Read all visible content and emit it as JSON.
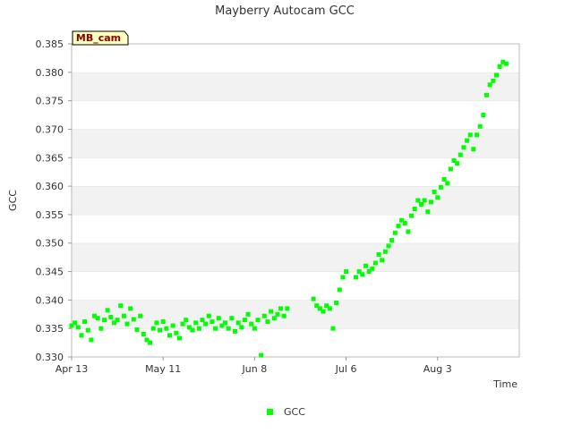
{
  "chart_data": {
    "type": "scatter",
    "title": "Mayberry Autocam GCC",
    "xlabel": "Time",
    "ylabel": "GCC",
    "site_tag": "MB_cam",
    "x_domain": [
      "2023-04-13",
      "2023-08-28"
    ],
    "xticks": [
      {
        "date": "2023-04-13",
        "label": "Apr 13"
      },
      {
        "date": "2023-05-11",
        "label": "May 11"
      },
      {
        "date": "2023-06-08",
        "label": "Jun 8"
      },
      {
        "date": "2023-07-06",
        "label": "Jul 6"
      },
      {
        "date": "2023-08-03",
        "label": "Aug 3"
      }
    ],
    "ylim": [
      0.33,
      0.385
    ],
    "yticks": [
      "0.330",
      "0.335",
      "0.340",
      "0.345",
      "0.350",
      "0.355",
      "0.360",
      "0.365",
      "0.370",
      "0.375",
      "0.380",
      "0.385"
    ],
    "grid": "alternating horizontal bands",
    "legend_position": "bottom-center",
    "series": [
      {
        "name": "GCC",
        "color": "#00ff00",
        "points": [
          [
            "2023-04-13",
            0.3355
          ],
          [
            "2023-04-14",
            0.336
          ],
          [
            "2023-04-15",
            0.3352
          ],
          [
            "2023-04-16",
            0.3338
          ],
          [
            "2023-04-17",
            0.3362
          ],
          [
            "2023-04-18",
            0.3347
          ],
          [
            "2023-04-19",
            0.333
          ],
          [
            "2023-04-20",
            0.3372
          ],
          [
            "2023-04-21",
            0.3368
          ],
          [
            "2023-04-22",
            0.335
          ],
          [
            "2023-04-23",
            0.3365
          ],
          [
            "2023-04-24",
            0.3382
          ],
          [
            "2023-04-25",
            0.337
          ],
          [
            "2023-04-26",
            0.336
          ],
          [
            "2023-04-27",
            0.3365
          ],
          [
            "2023-04-28",
            0.339
          ],
          [
            "2023-04-29",
            0.3372
          ],
          [
            "2023-04-30",
            0.3358
          ],
          [
            "2023-05-01",
            0.3385
          ],
          [
            "2023-05-02",
            0.3366
          ],
          [
            "2023-05-03",
            0.3348
          ],
          [
            "2023-05-04",
            0.3372
          ],
          [
            "2023-05-05",
            0.334
          ],
          [
            "2023-05-06",
            0.333
          ],
          [
            "2023-05-07",
            0.3325
          ],
          [
            "2023-05-08",
            0.335
          ],
          [
            "2023-05-09",
            0.336
          ],
          [
            "2023-05-10",
            0.3347
          ],
          [
            "2023-05-11",
            0.3362
          ],
          [
            "2023-05-12",
            0.335
          ],
          [
            "2023-05-13",
            0.3338
          ],
          [
            "2023-05-14",
            0.3355
          ],
          [
            "2023-05-15",
            0.3342
          ],
          [
            "2023-05-16",
            0.3333
          ],
          [
            "2023-05-17",
            0.3358
          ],
          [
            "2023-05-18",
            0.3365
          ],
          [
            "2023-05-19",
            0.3352
          ],
          [
            "2023-05-20",
            0.3347
          ],
          [
            "2023-05-21",
            0.336
          ],
          [
            "2023-05-22",
            0.335
          ],
          [
            "2023-05-23",
            0.3365
          ],
          [
            "2023-05-24",
            0.3358
          ],
          [
            "2023-05-25",
            0.3372
          ],
          [
            "2023-05-26",
            0.3362
          ],
          [
            "2023-05-27",
            0.335
          ],
          [
            "2023-05-28",
            0.3368
          ],
          [
            "2023-05-29",
            0.3355
          ],
          [
            "2023-05-30",
            0.336
          ],
          [
            "2023-05-31",
            0.335
          ],
          [
            "2023-06-01",
            0.3368
          ],
          [
            "2023-06-02",
            0.3345
          ],
          [
            "2023-06-03",
            0.336
          ],
          [
            "2023-06-04",
            0.3352
          ],
          [
            "2023-06-05",
            0.3365
          ],
          [
            "2023-06-06",
            0.3375
          ],
          [
            "2023-06-07",
            0.3358
          ],
          [
            "2023-06-08",
            0.335
          ],
          [
            "2023-06-09",
            0.3365
          ],
          [
            "2023-06-10",
            0.3303
          ],
          [
            "2023-06-11",
            0.3372
          ],
          [
            "2023-06-12",
            0.3362
          ],
          [
            "2023-06-13",
            0.338
          ],
          [
            "2023-06-14",
            0.3368
          ],
          [
            "2023-06-15",
            0.3375
          ],
          [
            "2023-06-16",
            0.3385
          ],
          [
            "2023-06-17",
            0.3372
          ],
          [
            "2023-06-18",
            0.3385
          ],
          [
            "2023-06-26",
            0.3402
          ],
          [
            "2023-06-27",
            0.339
          ],
          [
            "2023-06-28",
            0.3385
          ],
          [
            "2023-06-29",
            0.338
          ],
          [
            "2023-06-30",
            0.339
          ],
          [
            "2023-07-01",
            0.3385
          ],
          [
            "2023-07-02",
            0.335
          ],
          [
            "2023-07-03",
            0.3395
          ],
          [
            "2023-07-04",
            0.3418
          ],
          [
            "2023-07-05",
            0.344
          ],
          [
            "2023-07-06",
            0.345
          ],
          [
            "2023-07-09",
            0.344
          ],
          [
            "2023-07-10",
            0.345
          ],
          [
            "2023-07-11",
            0.3445
          ],
          [
            "2023-07-12",
            0.346
          ],
          [
            "2023-07-13",
            0.345
          ],
          [
            "2023-07-14",
            0.3455
          ],
          [
            "2023-07-15",
            0.3465
          ],
          [
            "2023-07-16",
            0.348
          ],
          [
            "2023-07-17",
            0.347
          ],
          [
            "2023-07-18",
            0.3485
          ],
          [
            "2023-07-19",
            0.3495
          ],
          [
            "2023-07-20",
            0.3505
          ],
          [
            "2023-07-21",
            0.3518
          ],
          [
            "2023-07-22",
            0.353
          ],
          [
            "2023-07-23",
            0.354
          ],
          [
            "2023-07-24",
            0.3535
          ],
          [
            "2023-07-25",
            0.352
          ],
          [
            "2023-07-26",
            0.3548
          ],
          [
            "2023-07-27",
            0.356
          ],
          [
            "2023-07-28",
            0.3575
          ],
          [
            "2023-07-29",
            0.3568
          ],
          [
            "2023-07-30",
            0.3575
          ],
          [
            "2023-07-31",
            0.3555
          ],
          [
            "2023-08-01",
            0.3572
          ],
          [
            "2023-08-02",
            0.359
          ],
          [
            "2023-08-03",
            0.358
          ],
          [
            "2023-08-04",
            0.3598
          ],
          [
            "2023-08-05",
            0.3612
          ],
          [
            "2023-08-06",
            0.3605
          ],
          [
            "2023-08-07",
            0.363
          ],
          [
            "2023-08-08",
            0.3645
          ],
          [
            "2023-08-09",
            0.364
          ],
          [
            "2023-08-10",
            0.3655
          ],
          [
            "2023-08-11",
            0.3668
          ],
          [
            "2023-08-12",
            0.368
          ],
          [
            "2023-08-13",
            0.369
          ],
          [
            "2023-08-14",
            0.3665
          ],
          [
            "2023-08-15",
            0.369
          ],
          [
            "2023-08-16",
            0.3705
          ],
          [
            "2023-08-17",
            0.3725
          ],
          [
            "2023-08-18",
            0.376
          ],
          [
            "2023-08-19",
            0.3778
          ],
          [
            "2023-08-20",
            0.3785
          ],
          [
            "2023-08-21",
            0.3795
          ],
          [
            "2023-08-22",
            0.381
          ],
          [
            "2023-08-23",
            0.3818
          ],
          [
            "2023-08-24",
            0.3815
          ]
        ]
      }
    ]
  }
}
